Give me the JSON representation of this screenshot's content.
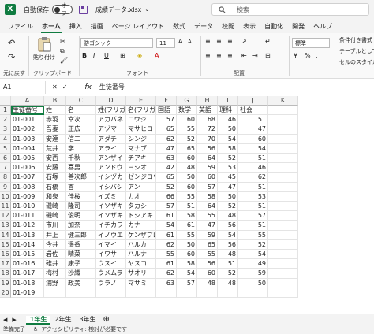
{
  "titlebar": {
    "logo": "X",
    "autosave_label": "自動保存",
    "toggle_label": "オフ",
    "filename": "成績データ.xlsx",
    "chevron": "⌄",
    "search_placeholder": "検索"
  },
  "menu": [
    "ファイル",
    "ホーム",
    "挿入",
    "描画",
    "ページ レイアウト",
    "数式",
    "データ",
    "校閲",
    "表示",
    "自動化",
    "開発",
    "ヘルプ"
  ],
  "ribbon": {
    "undo_label": "元に戻す",
    "paste_label": "貼り付け",
    "clipboard_label": "クリップボード",
    "font_name": "游ゴシック",
    "font_size": "11",
    "font_label": "フォント",
    "align_label": "配置",
    "num_format": "標準",
    "cond_format": "条件付き書式",
    "table_format": "テーブルとして",
    "cell_style": "セルのスタイル",
    "bold": "B",
    "italic": "I",
    "underline": "U"
  },
  "formula": {
    "namebox": "A1",
    "fx": "fx",
    "value": "生徒番号"
  },
  "columns": [
    "A",
    "B",
    "C",
    "D",
    "E",
    "F",
    "G",
    "H",
    "I",
    "J",
    "K"
  ],
  "header_row": [
    "生徒番号",
    "姓",
    "名",
    "姓(フリガナ)",
    "名(フリガナ)",
    "国語",
    "数学",
    "英語",
    "理科",
    "社会"
  ],
  "rows": [
    [
      "01-001",
      "赤羽",
      "幸次",
      "アカバネ",
      "コウジ",
      "57",
      "60",
      "68",
      "46",
      "51"
    ],
    [
      "01-002",
      "吾妻",
      "正広",
      "アヅマ",
      "マサヒロ",
      "65",
      "55",
      "72",
      "50",
      "47"
    ],
    [
      "01-003",
      "安達",
      "信二",
      "アダチ",
      "シンジ",
      "62",
      "52",
      "70",
      "54",
      "60"
    ],
    [
      "01-004",
      "荒井",
      "学",
      "アライ",
      "マナブ",
      "47",
      "65",
      "56",
      "58",
      "54"
    ],
    [
      "01-005",
      "安西",
      "千秋",
      "アンザイ",
      "チアキ",
      "63",
      "60",
      "64",
      "52",
      "51"
    ],
    [
      "01-006",
      "安藤",
      "喜男",
      "アンドウ",
      "ヨシオ",
      "42",
      "48",
      "59",
      "53",
      "46"
    ],
    [
      "01-007",
      "石塚",
      "善次郎",
      "イシヅカ",
      "ゼンジロウ",
      "65",
      "50",
      "60",
      "45",
      "62"
    ],
    [
      "01-008",
      "石橋",
      "杏",
      "イシバシ",
      "アン",
      "52",
      "60",
      "57",
      "47",
      "51"
    ],
    [
      "01-009",
      "和泉",
      "佳桜",
      "イズミ",
      "カオ",
      "66",
      "55",
      "58",
      "50",
      "53"
    ],
    [
      "01-010",
      "磯崎",
      "隆司",
      "イソザキ",
      "タカシ",
      "57",
      "51",
      "64",
      "52",
      "51"
    ],
    [
      "01-011",
      "磯崎",
      "俊明",
      "イソザキ",
      "トシアキ",
      "61",
      "58",
      "55",
      "48",
      "57"
    ],
    [
      "01-012",
      "市川",
      "加奈",
      "イチカワ",
      "カナ",
      "54",
      "61",
      "47",
      "56",
      "51"
    ],
    [
      "01-013",
      "井上",
      "健三郎",
      "イノウエ",
      "ケンザブロウ",
      "61",
      "55",
      "59",
      "54",
      "55"
    ],
    [
      "01-014",
      "今井",
      "遥香",
      "イマイ",
      "ハルカ",
      "62",
      "50",
      "65",
      "56",
      "52"
    ],
    [
      "01-015",
      "岩佐",
      "晴菜",
      "イワサ",
      "ハルナ",
      "55",
      "60",
      "55",
      "48",
      "54"
    ],
    [
      "01-016",
      "碓井",
      "康子",
      "ウスイ",
      "ヤスコ",
      "61",
      "58",
      "56",
      "51",
      "49"
    ],
    [
      "01-017",
      "梅村",
      "沙織",
      "ウメムラ",
      "サオリ",
      "62",
      "54",
      "60",
      "52",
      "59"
    ],
    [
      "01-018",
      "浦野",
      "政美",
      "ウラノ",
      "マサミ",
      "63",
      "57",
      "48",
      "48",
      "50"
    ],
    [
      "01-019",
      "",
      "",
      "",
      "",
      "",
      "",
      "",
      "",
      "",
      ""
    ]
  ],
  "sheets": [
    "1年生",
    "2年生",
    "3年生"
  ],
  "status": {
    "ready": "準備完了",
    "accessibility": "アクセシビリティ: 検討が必要です"
  }
}
